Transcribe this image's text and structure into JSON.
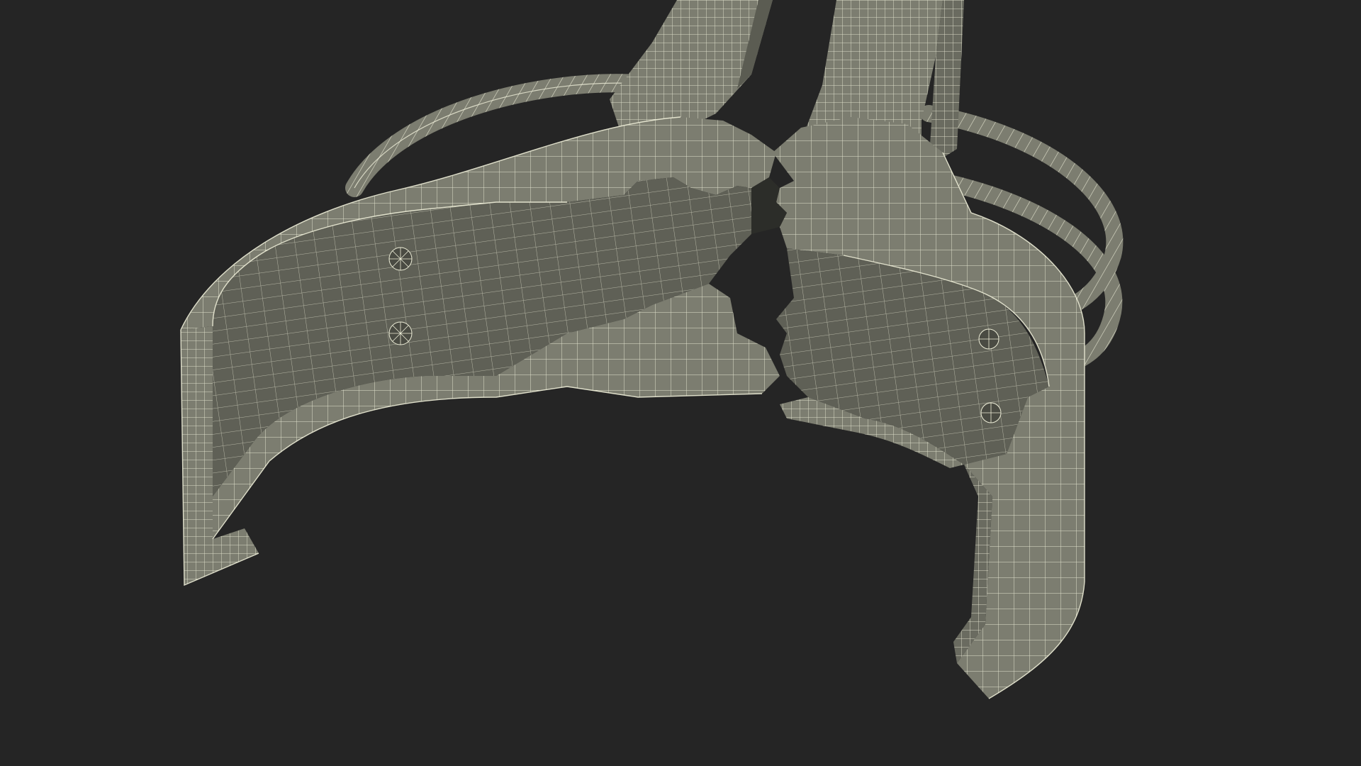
{
  "scene": {
    "subject": "wireframe-3d-model",
    "background_color": "#252525",
    "surface_color": "#7c7d70",
    "surface_shadow_color": "#5b5c52",
    "inner_dark_color": "#2c2d29",
    "wire_color": "#eeeed8"
  }
}
